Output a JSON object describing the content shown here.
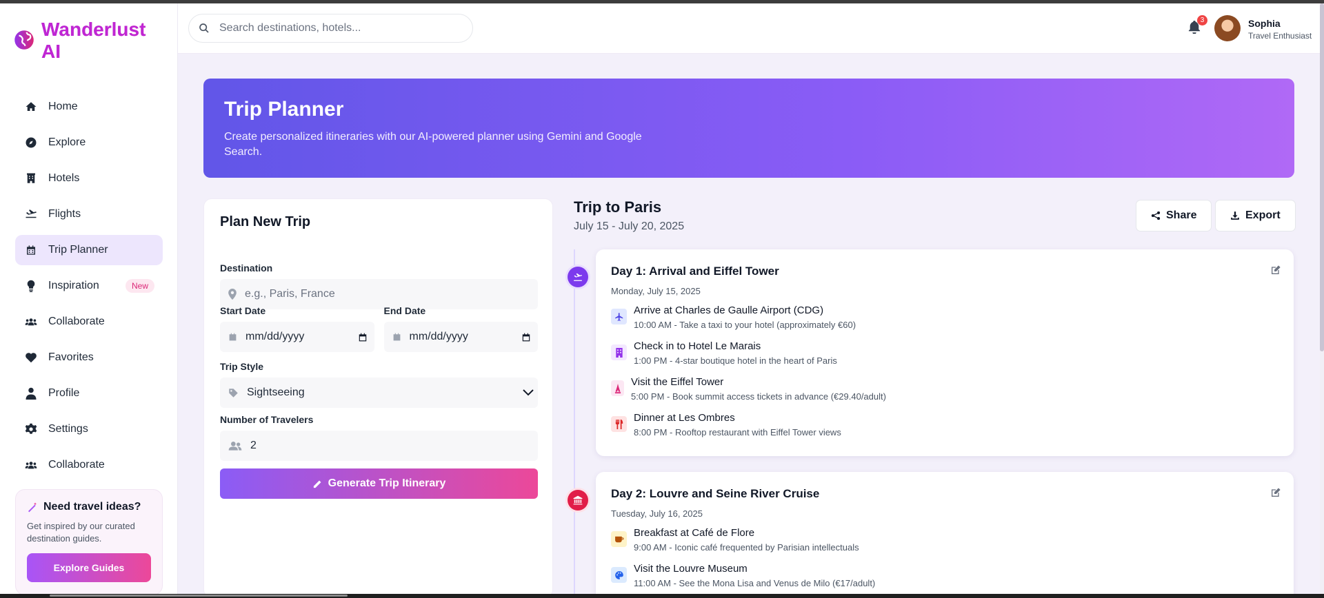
{
  "app": {
    "name": "Wanderlust AI",
    "accent": "#8b5cf6",
    "pink": "#ec4899"
  },
  "sidebar": {
    "items": [
      {
        "label": "Home",
        "icon": "home-icon"
      },
      {
        "label": "Explore",
        "icon": "compass-icon"
      },
      {
        "label": "Hotels",
        "icon": "building-icon"
      },
      {
        "label": "Flights",
        "icon": "plane-icon"
      },
      {
        "label": "Trip Planner",
        "icon": "calendar-icon",
        "active": true
      },
      {
        "label": "Inspiration",
        "icon": "lightbulb-icon",
        "badge": "New"
      },
      {
        "label": "Collaborate",
        "icon": "users-icon"
      },
      {
        "label": "Favorites",
        "icon": "heart-icon"
      },
      {
        "label": "Profile",
        "icon": "user-icon"
      },
      {
        "label": "Settings",
        "icon": "gear-icon"
      },
      {
        "label": "Collaborate",
        "icon": "users-icon"
      }
    ],
    "ideas": {
      "title": "Need travel ideas?",
      "description": "Get inspired by our curated destination guides.",
      "button": "Explore Guides"
    }
  },
  "header": {
    "search_placeholder": "Search destinations, hotels...",
    "notification_count": "3",
    "user_name": "Sophia",
    "user_role": "Travel Enthusiast"
  },
  "hero": {
    "title": "Trip Planner",
    "subtitle": "Create personalized itineraries with our AI-powered planner using Gemini and Google Search."
  },
  "plan": {
    "title": "Plan New Trip",
    "destination_label": "Destination",
    "destination_placeholder": "e.g., Paris, France",
    "start_label": "Start Date",
    "end_label": "End Date",
    "date_placeholder": "mm/dd/yyyy",
    "style_label": "Trip Style",
    "style_value": "Sightseeing",
    "travelers_label": "Number of Travelers",
    "travelers_value": "2",
    "generate_button": "Generate Trip Itinerary"
  },
  "itinerary": {
    "title": "Trip to Paris",
    "dates": "July 15 - July 20, 2025",
    "share_label": "Share",
    "export_label": "Export",
    "days": [
      {
        "title": "Day 1: Arrival and Eiffel Tower",
        "date": "Monday, July 15, 2025",
        "activities": [
          {
            "title": "Arrive at Charles de Gaulle Airport (CDG)",
            "detail": "10:00 AM - Take a taxi to your hotel (approximately €60)",
            "icon": "plane-icon"
          },
          {
            "title": "Check in to Hotel Le Marais",
            "detail": "1:00 PM - 4-star boutique hotel in the heart of Paris",
            "icon": "hotel-icon"
          },
          {
            "title": "Visit the Eiffel Tower",
            "detail": "5:00 PM - Book summit access tickets in advance (€29.40/adult)",
            "icon": "landmark-icon"
          },
          {
            "title": "Dinner at Les Ombres",
            "detail": "8:00 PM - Rooftop restaurant with Eiffel Tower views",
            "icon": "utensils-icon"
          }
        ]
      },
      {
        "title": "Day 2: Louvre and Seine River Cruise",
        "date": "Tuesday, July 16, 2025",
        "activities": [
          {
            "title": "Breakfast at Café de Flore",
            "detail": "9:00 AM - Iconic café frequented by Parisian intellectuals",
            "icon": "coffee-icon"
          },
          {
            "title": "Visit the Louvre Museum",
            "detail": "11:00 AM - See the Mona Lisa and Venus de Milo (€17/adult)",
            "icon": "palette-icon"
          }
        ]
      }
    ]
  }
}
